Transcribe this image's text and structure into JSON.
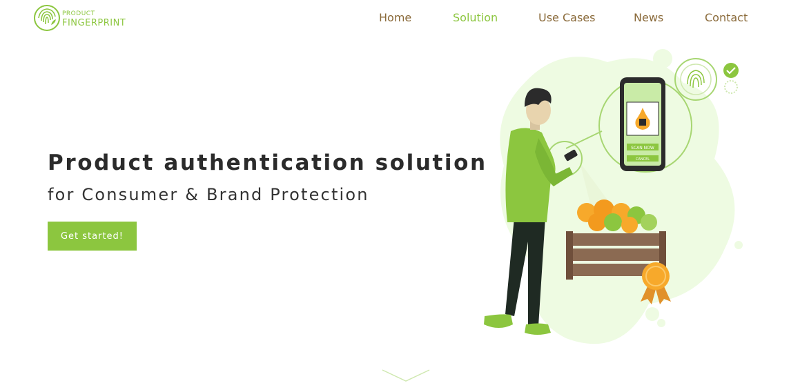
{
  "brand": {
    "line1": "PRODUCT",
    "line2": "FINGERPRINT",
    "accent_color": "#8cc63f"
  },
  "nav": {
    "items": [
      {
        "label": "Home",
        "active": false
      },
      {
        "label": "Solution",
        "active": true
      },
      {
        "label": "Use Cases",
        "active": false
      },
      {
        "label": "News",
        "active": false
      },
      {
        "label": "Contact",
        "active": false
      }
    ]
  },
  "hero": {
    "title": "Product authentication solution",
    "subtitle": "for Consumer & Brand Protection",
    "cta_label": "Get started!"
  },
  "phone": {
    "scan_button": "SCAN NOW",
    "cancel_button": "CANCEL"
  },
  "icons": {
    "fingerprint": "fingerprint-icon",
    "check": "check-icon",
    "scroll": "chevron-down-icon"
  }
}
